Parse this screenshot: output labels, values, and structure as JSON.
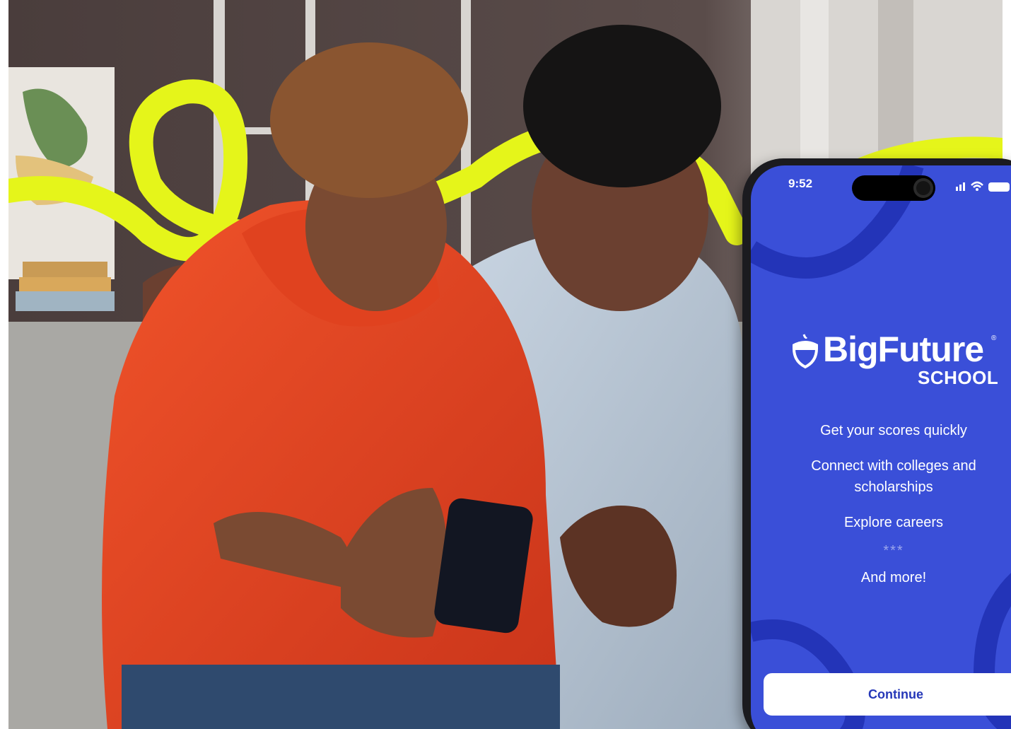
{
  "phone": {
    "status_time": "9:52",
    "signal_icon": "signal-bars-icon",
    "wifi_icon": "wifi-icon",
    "battery_icon": "battery-icon"
  },
  "app": {
    "logo_icon": "acorn-icon",
    "logo_text": "BigFuture",
    "logo_registered": "®",
    "logo_subtext": "SCHOOL",
    "features": [
      "Get your scores quickly",
      "Connect with colleges and scholarships",
      "Explore careers"
    ],
    "separator": "***",
    "more": "And more!",
    "continue_label": "Continue"
  },
  "colors": {
    "app_blue": "#3a4fd8",
    "swirl_blue": "#2334b8",
    "accent_yellow": "#e5f51a",
    "button_text": "#2638b8"
  }
}
